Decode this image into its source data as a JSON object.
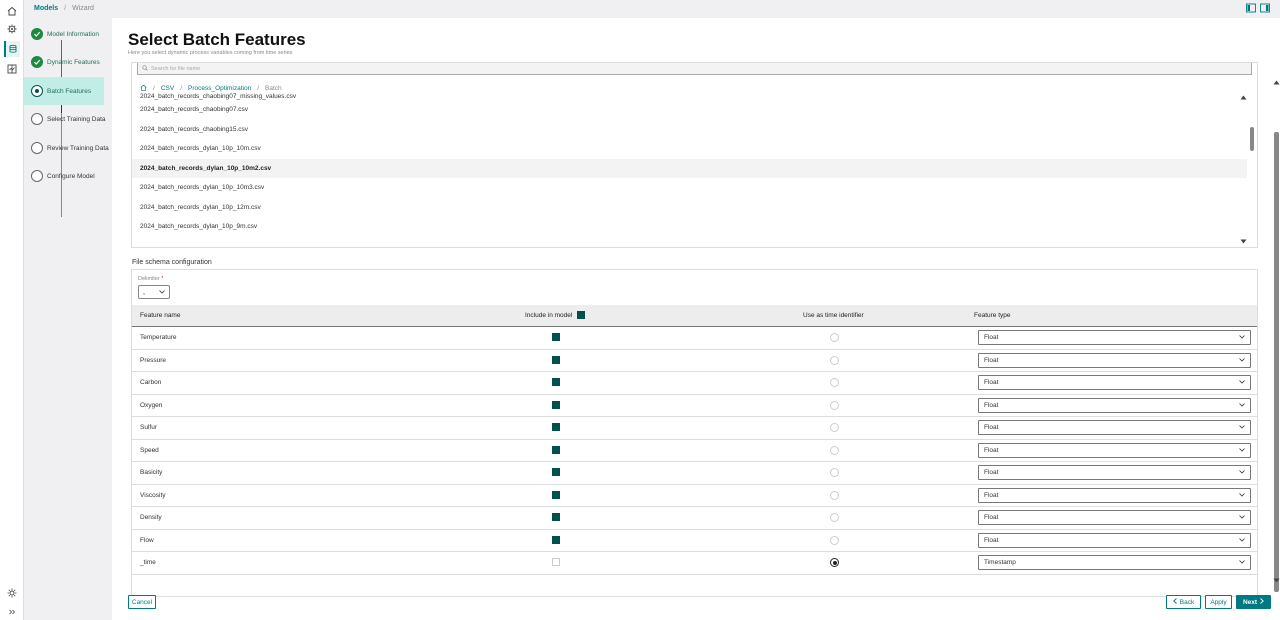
{
  "breadcrumb": {
    "models": "Models",
    "wizard": "Wizard"
  },
  "steps": [
    {
      "label": "Model Information",
      "state": "done"
    },
    {
      "label": "Dynamic Features",
      "state": "done"
    },
    {
      "label": "Batch Features",
      "state": "current"
    },
    {
      "label": "Select Training Data",
      "state": "pending"
    },
    {
      "label": "Review Training Data",
      "state": "pending"
    },
    {
      "label": "Configure Model",
      "state": "pending"
    }
  ],
  "page": {
    "title": "Select Batch Features",
    "subtitle": "Here you select dynamic process variables coming from time series"
  },
  "search": {
    "placeholder": "Search for file name"
  },
  "path": {
    "csv": "CSV",
    "folder": "Process_Optimization",
    "current": "Batch"
  },
  "files": {
    "partial": "2024_batch_records_chaobing07_missing_values.csv",
    "items": [
      "2024_batch_records_chaobing07.csv",
      "2024_batch_records_chaobing15.csv",
      "2024_batch_records_dylan_10p_10m.csv",
      "2024_batch_records_dylan_10p_10m2.csv",
      "2024_batch_records_dylan_10p_10m3.csv",
      "2024_batch_records_dylan_10p_12m.csv",
      "2024_batch_records_dylan_10p_9m.csv"
    ],
    "selected": "2024_batch_records_dylan_10p_10m2.csv"
  },
  "schema": {
    "title": "File schema configuration",
    "delimiter_label": "Delimiter",
    "delimiter_required": "*",
    "delimiter_value": ",",
    "headers": {
      "feature_name": "Feature name",
      "include": "Include in model",
      "time_id": "Use as time identifier",
      "feature_type": "Feature type"
    },
    "rows": [
      {
        "name": "Temperature",
        "include": true,
        "time": false,
        "type": "Float"
      },
      {
        "name": "Pressure",
        "include": true,
        "time": false,
        "type": "Float"
      },
      {
        "name": "Carbon",
        "include": true,
        "time": false,
        "type": "Float"
      },
      {
        "name": "Oxygen",
        "include": true,
        "time": false,
        "type": "Float"
      },
      {
        "name": "Sulfur",
        "include": true,
        "time": false,
        "type": "Float"
      },
      {
        "name": "Speed",
        "include": true,
        "time": false,
        "type": "Float"
      },
      {
        "name": "Basicity",
        "include": true,
        "time": false,
        "type": "Float"
      },
      {
        "name": "Viscosity",
        "include": true,
        "time": false,
        "type": "Float"
      },
      {
        "name": "Density",
        "include": true,
        "time": false,
        "type": "Float"
      },
      {
        "name": "Flow",
        "include": true,
        "time": false,
        "type": "Float"
      },
      {
        "name": "_time",
        "include": false,
        "time": true,
        "type": "Timestamp"
      }
    ]
  },
  "buttons": {
    "cancel": "Cancel",
    "back": "Back",
    "apply": "Apply",
    "next": "Next"
  },
  "colors": {
    "accent": "#007a80",
    "done": "#1f8a3f",
    "checkbox": "#00504d",
    "current_step_bg": "#c2ede7"
  }
}
